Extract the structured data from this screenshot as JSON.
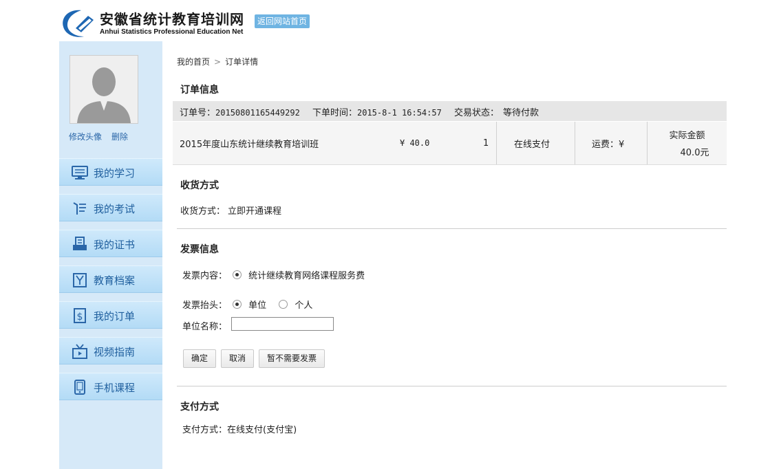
{
  "header": {
    "title": "安徽省统计教育培训网",
    "subtitle": "Anhui Statistics Professional  Education Net",
    "back_home": "返回网站首页"
  },
  "sidebar": {
    "avatar_links": [
      "修改头像",
      "删除"
    ],
    "menu": [
      {
        "label": "我的学习",
        "icon": "monitor-icon"
      },
      {
        "label": "我的考试",
        "icon": "exam-icon"
      },
      {
        "label": "我的证书",
        "icon": "certificate-icon"
      },
      {
        "label": "教育档案",
        "icon": "archive-icon"
      },
      {
        "label": "我的订单",
        "icon": "order-icon"
      },
      {
        "label": "视频指南",
        "icon": "tv-icon"
      },
      {
        "label": "手机课程",
        "icon": "mobile-icon"
      }
    ]
  },
  "breadcrumb": {
    "home": "我的首页",
    "current": "订单详情"
  },
  "order": {
    "section_title": "订单信息",
    "number_label": "订单号：",
    "number": "20150801165449292",
    "time_label": "下单时间：",
    "time": "2015-8-1 16:54:57",
    "status_label": "交易状态：",
    "status": "等待付款",
    "course": "2015年度山东统计继续教育培训班",
    "price": "¥ 40.0",
    "quantity": "1",
    "pay_type": "在线支付",
    "shipping": "运费：¥",
    "total_label": "实际金额",
    "total": "40.0元"
  },
  "delivery": {
    "section_title": "收货方式",
    "label": "收货方式：",
    "value": "立即开通课程"
  },
  "invoice": {
    "section_title": "发票信息",
    "content_label": "发票内容：",
    "content_option": "统计继续教育网络课程服务费",
    "header_label": "发票抬头：",
    "header_options": [
      "单位",
      "个人"
    ],
    "company_label": "单位名称：",
    "company_value": "",
    "buttons": [
      "确定",
      "取消",
      "暂不需要发票"
    ]
  },
  "payment": {
    "section_title": "支付方式",
    "label": "支付方式：",
    "value": "在线支付(支付宝)"
  },
  "colors": {
    "sidebar_bg": "#d6e9f8",
    "menu_text": "#1f5f9e",
    "back_home_bg": "#6fb4e2",
    "order_bar_bg": "#e6e6e6"
  }
}
